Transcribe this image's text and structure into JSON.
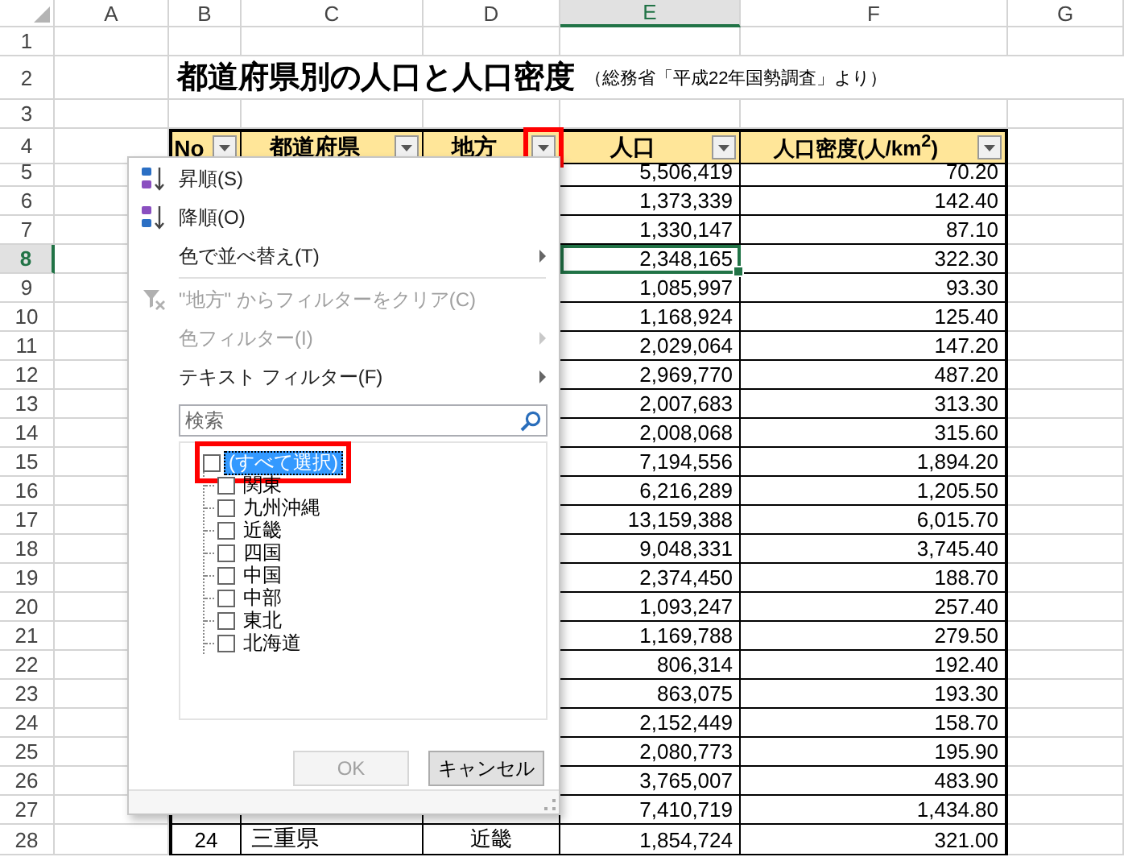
{
  "columns": [
    {
      "label": "A",
      "selected": false
    },
    {
      "label": "B",
      "selected": false
    },
    {
      "label": "C",
      "selected": false
    },
    {
      "label": "D",
      "selected": false
    },
    {
      "label": "E",
      "selected": true
    },
    {
      "label": "F",
      "selected": false
    },
    {
      "label": "G",
      "selected": false
    }
  ],
  "rows": [
    {
      "kind": "blank",
      "header": "1",
      "selected": false
    },
    {
      "kind": "title",
      "header": "2",
      "selected": false,
      "title": "都道府県別の人口と人口密度",
      "note": "（総務省「平成22年国勢調査」より）"
    },
    {
      "kind": "blank",
      "header": "3",
      "selected": false
    },
    {
      "kind": "table_header",
      "header": "4",
      "selected": false,
      "cells": [
        {
          "label": "No",
          "highlighted": false
        },
        {
          "label": "都道府県",
          "highlighted": false
        },
        {
          "label": "地方",
          "highlighted": true
        },
        {
          "label": "人口",
          "highlighted": false
        },
        {
          "label": "人口密度(人/km$^{2}$)",
          "highlighted": false
        }
      ]
    },
    {
      "kind": "data",
      "header": "5",
      "selected": false,
      "population": "5,506,419",
      "density": "70.20",
      "active": false
    },
    {
      "kind": "data",
      "header": "6",
      "selected": false,
      "population": "1,373,339",
      "density": "142.40",
      "active": false
    },
    {
      "kind": "data",
      "header": "7",
      "selected": false,
      "population": "1,330,147",
      "density": "87.10",
      "active": false
    },
    {
      "kind": "data",
      "header": "8",
      "selected": true,
      "population": "2,348,165",
      "density": "322.30",
      "active": true
    },
    {
      "kind": "data",
      "header": "9",
      "selected": false,
      "population": "1,085,997",
      "density": "93.30",
      "active": false
    },
    {
      "kind": "data",
      "header": "10",
      "selected": false,
      "population": "1,168,924",
      "density": "125.40",
      "active": false
    },
    {
      "kind": "data",
      "header": "11",
      "selected": false,
      "population": "2,029,064",
      "density": "147.20",
      "active": false
    },
    {
      "kind": "data",
      "header": "12",
      "selected": false,
      "population": "2,969,770",
      "density": "487.20",
      "active": false
    },
    {
      "kind": "data",
      "header": "13",
      "selected": false,
      "population": "2,007,683",
      "density": "313.30",
      "active": false
    },
    {
      "kind": "data",
      "header": "14",
      "selected": false,
      "population": "2,008,068",
      "density": "315.60",
      "active": false
    },
    {
      "kind": "data",
      "header": "15",
      "selected": false,
      "population": "7,194,556",
      "density": "1,894.20",
      "active": false
    },
    {
      "kind": "data",
      "header": "16",
      "selected": false,
      "population": "6,216,289",
      "density": "1,205.50",
      "active": false
    },
    {
      "kind": "data",
      "header": "17",
      "selected": false,
      "population": "13,159,388",
      "density": "6,015.70",
      "active": false
    },
    {
      "kind": "data",
      "header": "18",
      "selected": false,
      "population": "9,048,331",
      "density": "3,745.40",
      "active": false
    },
    {
      "kind": "data",
      "header": "19",
      "selected": false,
      "population": "2,374,450",
      "density": "188.70",
      "active": false
    },
    {
      "kind": "data",
      "header": "20",
      "selected": false,
      "population": "1,093,247",
      "density": "257.40",
      "active": false
    },
    {
      "kind": "data",
      "header": "21",
      "selected": false,
      "population": "1,169,788",
      "density": "279.50",
      "active": false
    },
    {
      "kind": "data",
      "header": "22",
      "selected": false,
      "population": "806,314",
      "density": "192.40",
      "active": false
    },
    {
      "kind": "data",
      "header": "23",
      "selected": false,
      "population": "863,075",
      "density": "193.30",
      "active": false
    },
    {
      "kind": "data",
      "header": "24",
      "selected": false,
      "population": "2,152,449",
      "density": "158.70",
      "active": false
    },
    {
      "kind": "data",
      "header": "25",
      "selected": false,
      "population": "2,080,773",
      "density": "195.90",
      "active": false
    },
    {
      "kind": "data",
      "header": "26",
      "selected": false,
      "population": "3,765,007",
      "density": "483.90",
      "active": false
    },
    {
      "kind": "data",
      "header": "27",
      "selected": false,
      "population": "7,410,719",
      "density": "1,434.80",
      "active": false
    },
    {
      "kind": "data",
      "header": "28",
      "selected": false,
      "no": "24",
      "prefecture": "三重県",
      "region": "近畿",
      "population": "1,854,724",
      "density": "321.00",
      "active": false
    }
  ],
  "filter_menu": {
    "items": [
      {
        "kind": "sort_ascending",
        "label": "昇順(S)",
        "disabled": false
      },
      {
        "kind": "sort_descending",
        "label": "降順(O)",
        "disabled": false
      },
      {
        "kind": "submenu",
        "label": "色で並べ替え(T)",
        "disabled": false
      },
      {
        "kind": "separator"
      },
      {
        "kind": "clear_filter",
        "label": "\"地方\" からフィルターをクリア(C)",
        "disabled": true
      },
      {
        "kind": "submenu",
        "label": "色フィルター(I)",
        "disabled": true
      },
      {
        "kind": "submenu",
        "label": "テキスト フィルター(F)",
        "disabled": false
      }
    ],
    "search": {
      "placeholder": "検索"
    },
    "values": [
      {
        "label": "(すべて選択)",
        "checked": false,
        "selected": true,
        "highlighted": true,
        "children": [
          {
            "label": "関東",
            "checked": false,
            "selected": false,
            "highlighted": false
          },
          {
            "label": "九州沖縄",
            "checked": false,
            "selected": false,
            "highlighted": false
          },
          {
            "label": "近畿",
            "checked": false,
            "selected": false,
            "highlighted": false
          },
          {
            "label": "四国",
            "checked": false,
            "selected": false,
            "highlighted": false
          },
          {
            "label": "中国",
            "checked": false,
            "selected": false,
            "highlighted": false
          },
          {
            "label": "中部",
            "checked": false,
            "selected": false,
            "highlighted": false
          },
          {
            "label": "東北",
            "checked": false,
            "selected": false,
            "highlighted": false
          },
          {
            "label": "北海道",
            "checked": false,
            "selected": false,
            "highlighted": false
          }
        ]
      }
    ],
    "buttons": [
      {
        "label": "OK",
        "disabled": true
      },
      {
        "label": "キャンセル",
        "disabled": false
      }
    ]
  }
}
